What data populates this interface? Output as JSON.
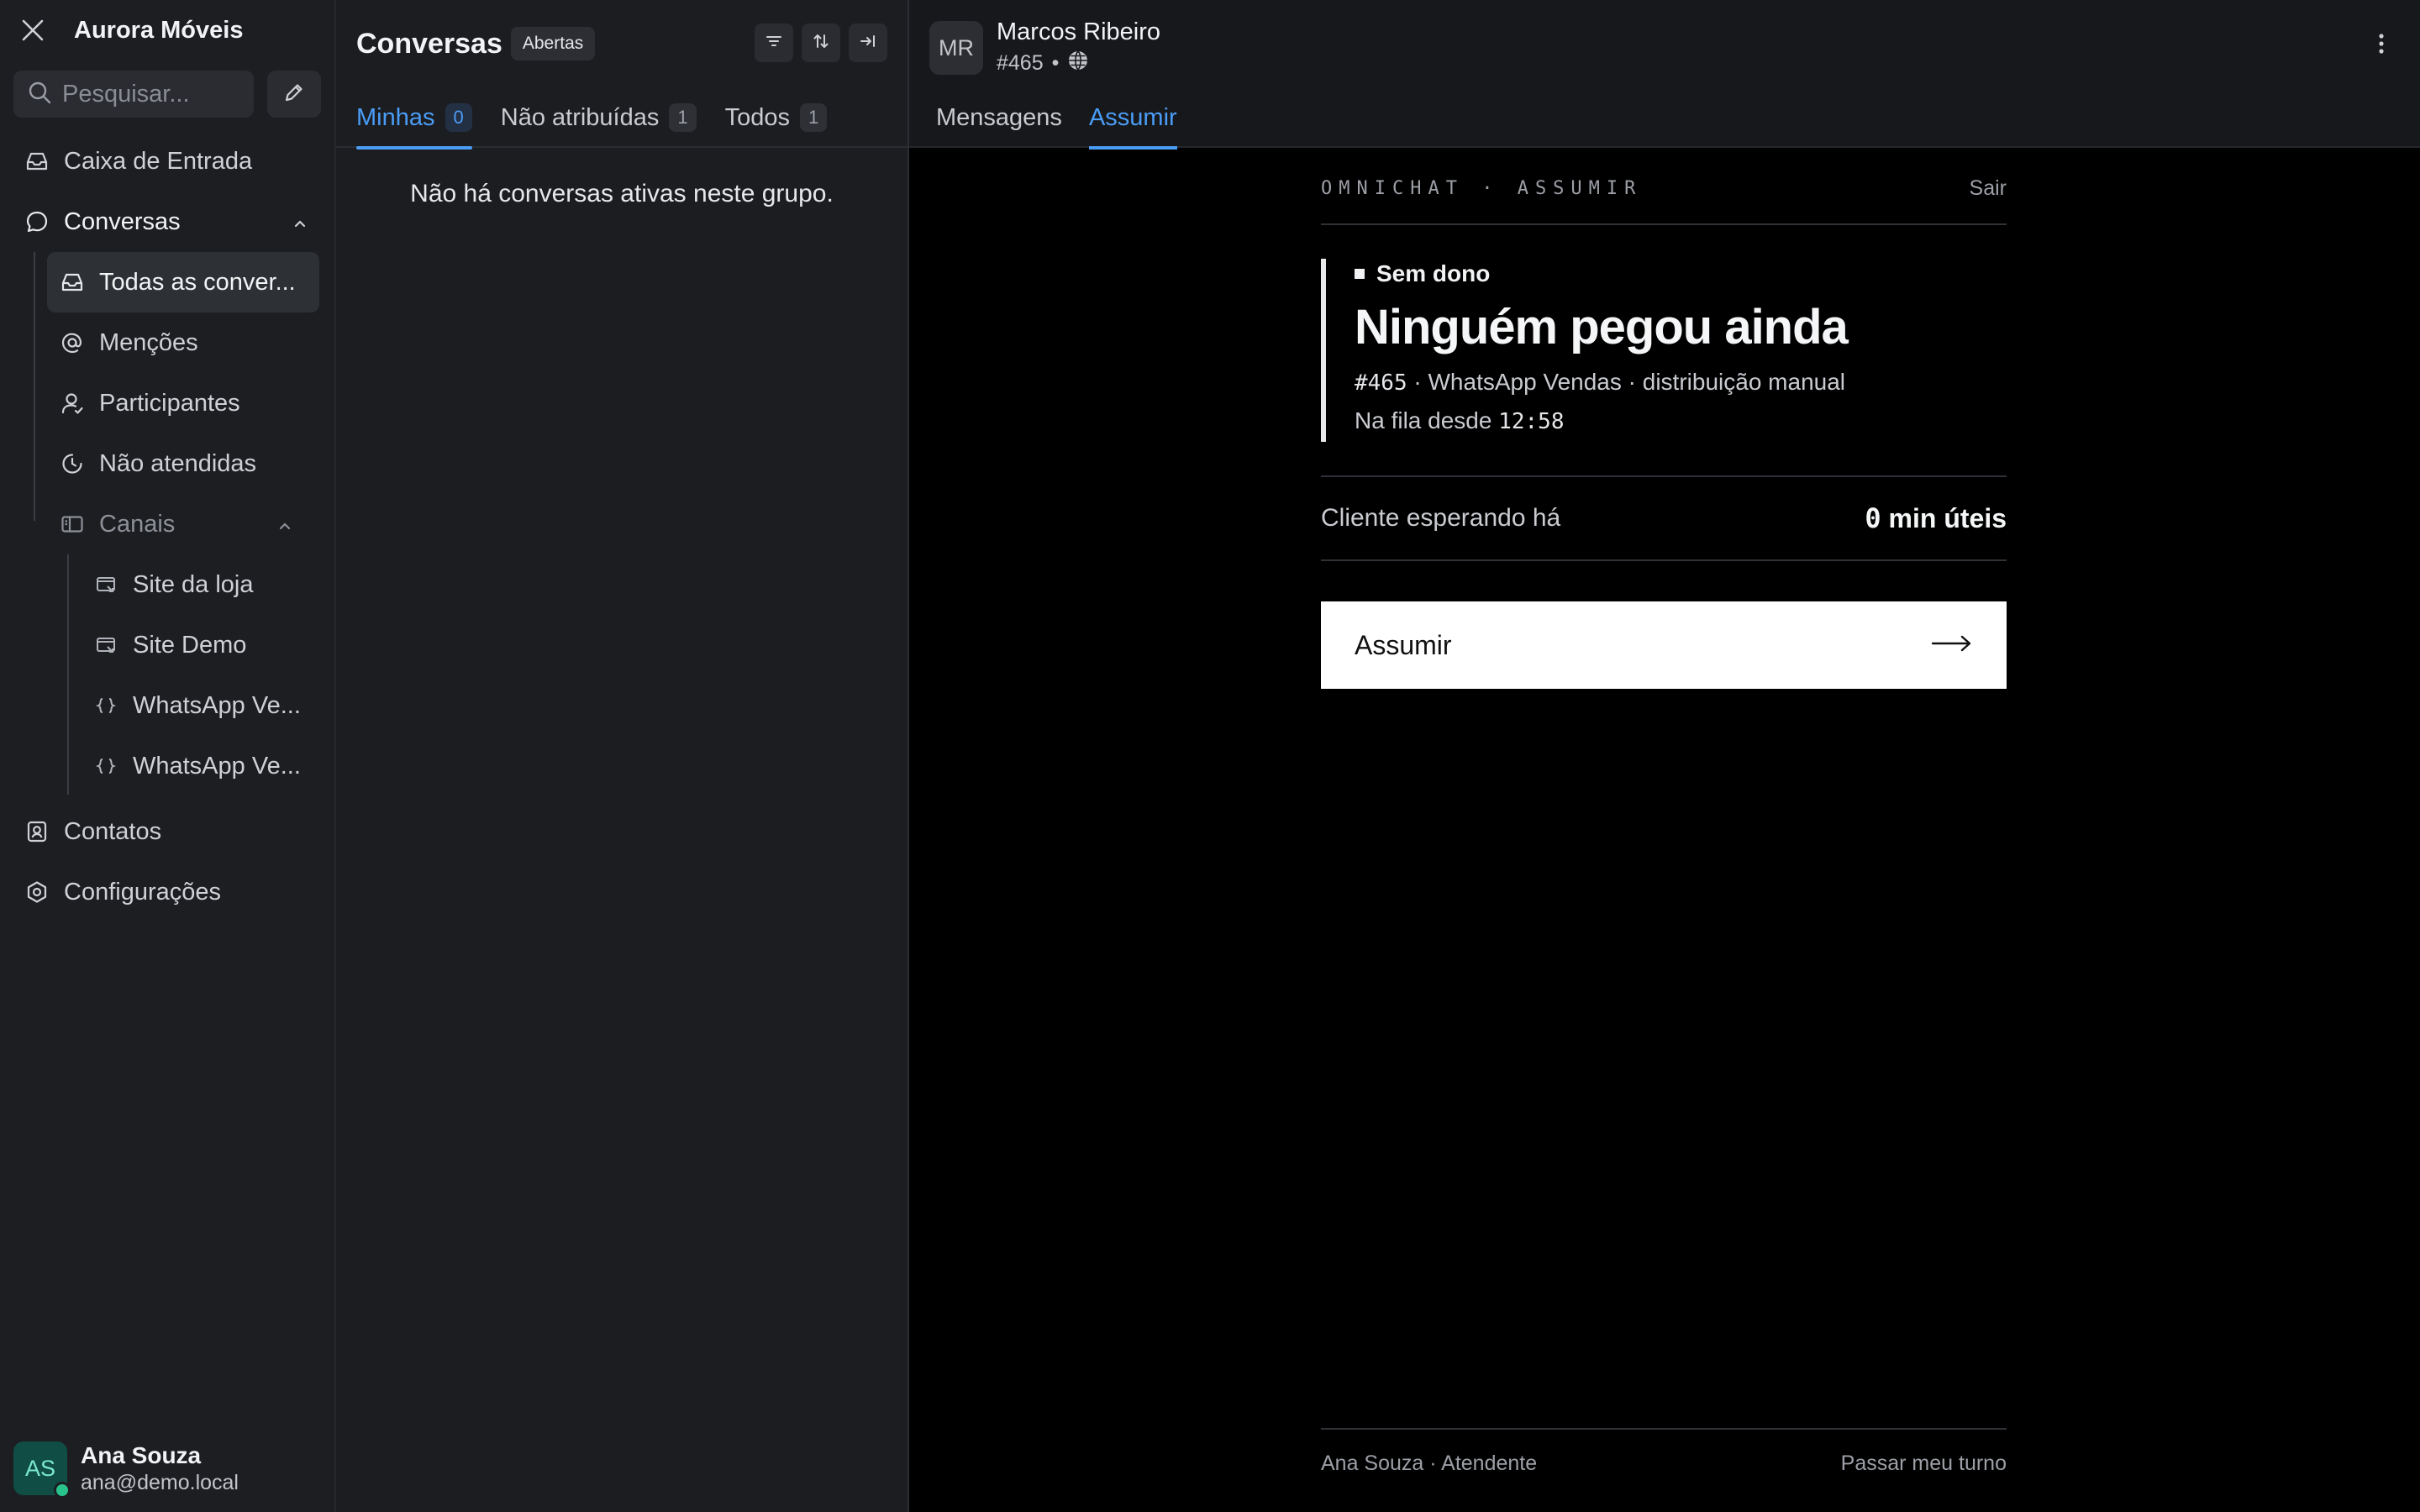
{
  "app": {
    "brand": "Aurora Móveis"
  },
  "search": {
    "placeholder": "Pesquisar..."
  },
  "sidebar": {
    "inbox": "Caixa de Entrada",
    "conversations": "Conversas",
    "sub": {
      "all": "Todas as conver...",
      "mentions": "Menções",
      "participants": "Participantes",
      "unattended": "Não atendidas",
      "channels": "Canais"
    },
    "channels": [
      {
        "label": "Site da loja",
        "icon": "website-icon"
      },
      {
        "label": "Site Demo",
        "icon": "website-icon"
      },
      {
        "label": "WhatsApp Ve...",
        "icon": "api-braces-icon"
      },
      {
        "label": "WhatsApp Ve...",
        "icon": "api-braces-icon"
      }
    ],
    "contacts": "Contatos",
    "settings": "Configurações"
  },
  "user": {
    "initials": "AS",
    "name": "Ana Souza",
    "email": "ana@demo.local"
  },
  "list": {
    "title": "Conversas",
    "status_badge": "Abertas",
    "tabs": [
      {
        "label": "Minhas",
        "count": "0"
      },
      {
        "label": "Não atribuídas",
        "count": "1"
      },
      {
        "label": "Todos",
        "count": "1"
      }
    ],
    "empty_text": "Não há conversas ativas neste grupo."
  },
  "contact": {
    "initials": "MR",
    "name": "Marcos Ribeiro",
    "id": "#465",
    "sep": "•"
  },
  "pane_tabs": {
    "messages": "Mensagens",
    "assume": "Assumir"
  },
  "panel": {
    "kicker": "OMNICHAT · ASSUMIR",
    "exit": "Sair",
    "status": "Sem dono",
    "title": "Ninguém pegou ainda",
    "meta_id": "#465",
    "meta_rest": " · WhatsApp Vendas · distribuição manual",
    "queue_label": "Na fila desde ",
    "queue_time": "12:58",
    "wait_label": "Cliente esperando há",
    "wait_number": "0",
    "wait_unit": " min úteis",
    "assume_button": "Assumir",
    "footer_left": "Ana Souza · Atendente",
    "footer_right": "Passar meu turno"
  },
  "colors": {
    "accent": "#4a9cf5",
    "online": "#29c48c",
    "avatar_bg": "#0f4d45"
  }
}
